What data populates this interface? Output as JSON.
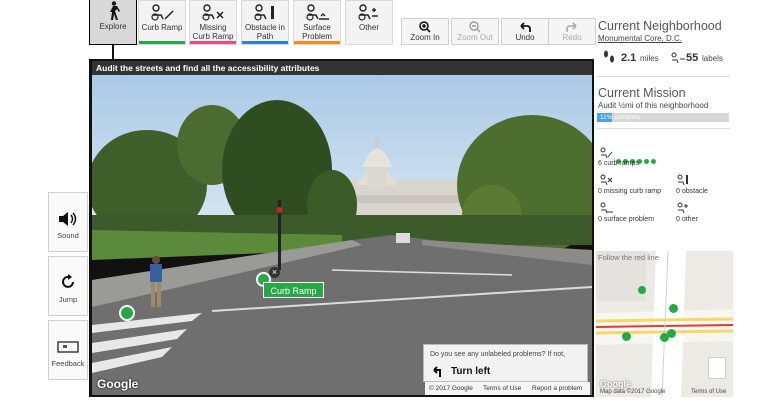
{
  "toolbar": {
    "tools": [
      {
        "label": "Explore"
      },
      {
        "label": "Curb Ramp"
      },
      {
        "label": "Missing Curb Ramp"
      },
      {
        "label": "Obstacle in Path"
      },
      {
        "label": "Surface Problem"
      },
      {
        "label": "Other"
      }
    ],
    "zoom_in": "Zoom In",
    "zoom_out": "Zoom Out",
    "undo": "Undo",
    "redo": "Redo"
  },
  "banner": "Audit the streets and find all the accessibility attributes",
  "panorama": {
    "label_tag": "Curb Ramp",
    "close_glyph": "×",
    "google_logo": "Google",
    "copyright": "© 2017 Google",
    "terms": "Terms of Use",
    "report": "Report a problem"
  },
  "tooltip": {
    "question": "Do you see any unlabeled problems? If not,",
    "action": "Turn left"
  },
  "side": {
    "sound": "Sound",
    "jump": "Jump",
    "feedback": "Feedback"
  },
  "neighborhood": {
    "title": "Current Neighborhood",
    "name": "Monumental Core, D.C.",
    "miles_value": "2.1",
    "miles_unit": "miles",
    "labels_value": "55",
    "labels_unit": "labels"
  },
  "mission": {
    "title": "Current Mission",
    "desc": "Audit ½mi of this neighborhood",
    "progress_text": "11% complete",
    "progress": 0.11
  },
  "counts": {
    "curb_ramps": "6 curb ramps",
    "missing": "0 missing curb ramp",
    "obstacle": "0 obstacle",
    "surface": "0 surface problem",
    "other": "0 other"
  },
  "minimap": {
    "hint": "Follow the red line",
    "data_credit": "Map data ©2017 Google",
    "terms": "Terms of Use",
    "logo": "Google"
  },
  "colors": {
    "curb_ramp": "#27a847",
    "missing": "#e84c8a",
    "obstacle": "#2b7fd4",
    "surface": "#f28c1f",
    "progress": "#4aa3df",
    "route": "#e53935"
  }
}
